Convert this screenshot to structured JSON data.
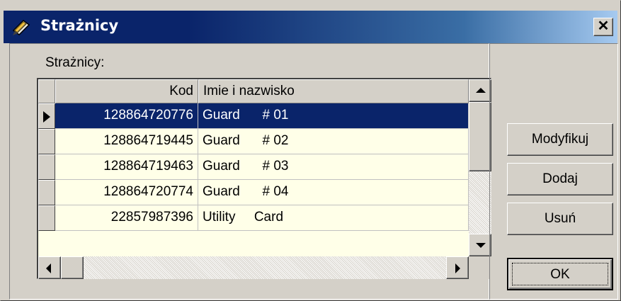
{
  "window": {
    "title": "Strażnicy",
    "close_glyph": "✕",
    "icon": "notebook-pencil-icon"
  },
  "group": {
    "label": "Strażnicy:"
  },
  "grid": {
    "columns": [
      "Kod",
      "Imie i nazwisko"
    ],
    "rows": [
      {
        "code": "128864720776",
        "name": "Guard      # 01",
        "selected": true
      },
      {
        "code": "128864719445",
        "name": "Guard      # 02",
        "selected": false
      },
      {
        "code": "128864719463",
        "name": "Guard      # 03",
        "selected": false
      },
      {
        "code": "128864720774",
        "name": "Guard      # 04",
        "selected": false
      },
      {
        "code": "22857987396",
        "name": "Utility     Card",
        "selected": false
      }
    ]
  },
  "buttons": {
    "modify": "Modyfikuj",
    "add": "Dodaj",
    "delete": "Usuń",
    "ok": "OK"
  },
  "colors": {
    "title_gradient_start": "#0a246a",
    "title_gradient_end": "#a6caf0",
    "selection": "#0a246a",
    "grid_background": "#ffffe8",
    "face": "#d4d0c8"
  }
}
